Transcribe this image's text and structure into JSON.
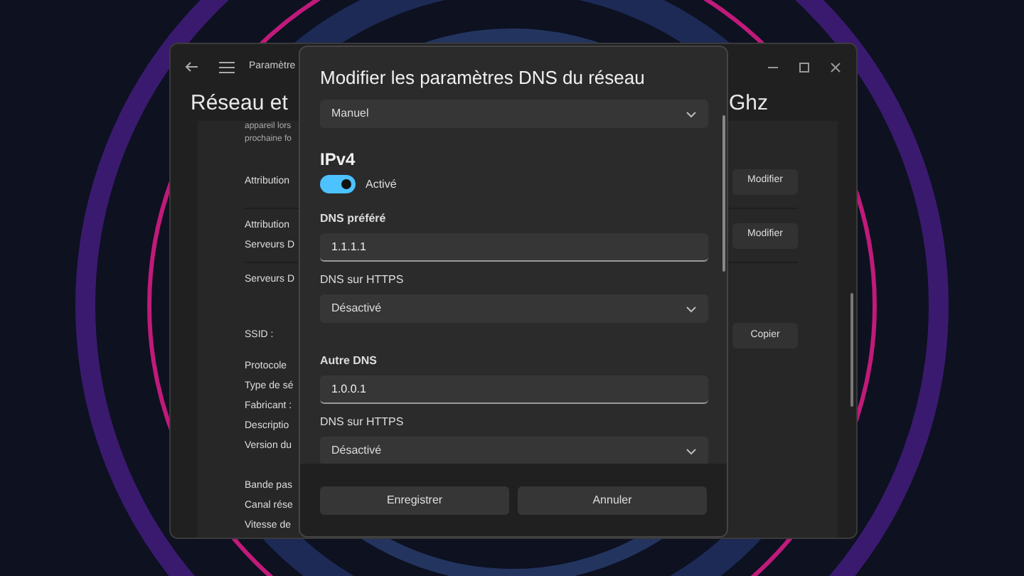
{
  "settings_window": {
    "title": "Paramètre",
    "heading_left": "Réseau et",
    "heading_right": "Ghz",
    "rows": [
      {
        "kind": "note",
        "lines": [
          "appareil lors",
          "prochaine fo"
        ]
      },
      {
        "kind": "action",
        "label": "Attribution",
        "button": "Modifier"
      },
      {
        "kind": "action",
        "label": "Attribution",
        "extra": "Serveurs D",
        "button": "Modifier"
      },
      {
        "kind": "plain",
        "label": "Serveurs D"
      },
      {
        "kind": "action",
        "label": "SSID :",
        "button": "Copier"
      },
      {
        "kind": "plain",
        "label": "Protocole"
      },
      {
        "kind": "plain",
        "label": "Type de sé"
      },
      {
        "kind": "plain",
        "label": "Fabricant :"
      },
      {
        "kind": "plain",
        "label": "Descriptio"
      },
      {
        "kind": "plain",
        "label": "Version du"
      },
      {
        "kind": "gap"
      },
      {
        "kind": "plain",
        "label": "Bande pas"
      },
      {
        "kind": "plain",
        "label": "Canal rése"
      },
      {
        "kind": "plain",
        "label": "Vitesse de"
      }
    ]
  },
  "dialog": {
    "title": "Modifier les paramètres DNS du réseau",
    "mode": {
      "value": "Manuel"
    },
    "section": "IPv4",
    "toggle": {
      "label": "Activé",
      "on": true
    },
    "fields": [
      {
        "kind": "input",
        "label": "DNS préféré",
        "value": "1.1.1.1"
      },
      {
        "kind": "select",
        "label": "DNS sur HTTPS",
        "value": "Désactivé"
      },
      {
        "kind": "input",
        "label": "Autre DNS",
        "value": "1.0.0.1"
      },
      {
        "kind": "select",
        "label": "DNS sur HTTPS",
        "value": "Désactivé"
      }
    ],
    "buttons": [
      "Enregistrer",
      "Annuler"
    ]
  }
}
